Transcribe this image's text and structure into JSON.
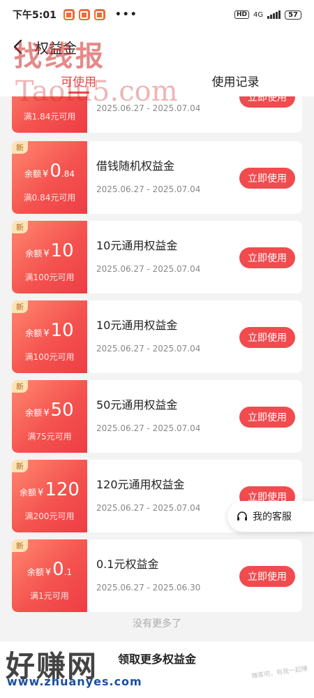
{
  "status_bar": {
    "time": "下午5:01",
    "network": "4G",
    "battery": "57"
  },
  "header": {
    "title": "权益金"
  },
  "tabs": [
    {
      "label": "可使用",
      "active": true
    },
    {
      "label": "使用记录",
      "active": false
    }
  ],
  "coupons": [
    {
      "new_tag": "",
      "prefix": "",
      "currency": "",
      "big": "",
      "decimal": "",
      "min_use": "满1.84元可用",
      "name": "",
      "date": "2025.06.27 - 2025.07.04",
      "button": "立即使用"
    },
    {
      "new_tag": "新",
      "prefix": "余额",
      "currency": "¥",
      "big": "0",
      "decimal": ".84",
      "min_use": "满0.84元可用",
      "name": "借钱随机权益金",
      "date": "2025.06.27 - 2025.07.04",
      "button": "立即使用"
    },
    {
      "new_tag": "新",
      "prefix": "余额",
      "currency": "¥",
      "big": "10",
      "decimal": "",
      "min_use": "满100元可用",
      "name": "10元通用权益金",
      "date": "2025.06.27 - 2025.07.04",
      "button": "立即使用"
    },
    {
      "new_tag": "新",
      "prefix": "余额",
      "currency": "¥",
      "big": "10",
      "decimal": "",
      "min_use": "满100元可用",
      "name": "10元通用权益金",
      "date": "2025.06.27 - 2025.07.04",
      "button": "立即使用"
    },
    {
      "new_tag": "新",
      "prefix": "余额",
      "currency": "¥",
      "big": "50",
      "decimal": "",
      "min_use": "满75元可用",
      "name": "50元通用权益金",
      "date": "2025.06.27 - 2025.07.04",
      "button": "立即使用"
    },
    {
      "new_tag": "新",
      "prefix": "余额",
      "currency": "¥",
      "big": "120",
      "decimal": "",
      "min_use": "满200元可用",
      "name": "120元通用权益金",
      "date": "2025.06.27 - 2025.07.04",
      "button": "立即使用"
    },
    {
      "new_tag": "新",
      "prefix": "余额",
      "currency": "¥",
      "big": "0",
      "decimal": ".1",
      "min_use": "满1元可用",
      "name": "0.1元权益金",
      "date": "2025.06.27 - 2025.06.30",
      "button": "立即使用"
    }
  ],
  "no_more_text": "没有更多了",
  "customer_service": "我的客服",
  "bottom_button": "领取更多权益金",
  "watermarks": {
    "top_text": "找线报",
    "top_url": "Taolu5.com",
    "bottom_text": "好赚网",
    "bottom_url": "www.zhuanyes.com",
    "corner": "赚客吧，有我一起赚"
  },
  "colors": {
    "accent": "#f04b4f",
    "ticket_start": "#ff8870",
    "ticket_end": "#ee3d45",
    "new_tag_bg": "#fde3b8"
  }
}
